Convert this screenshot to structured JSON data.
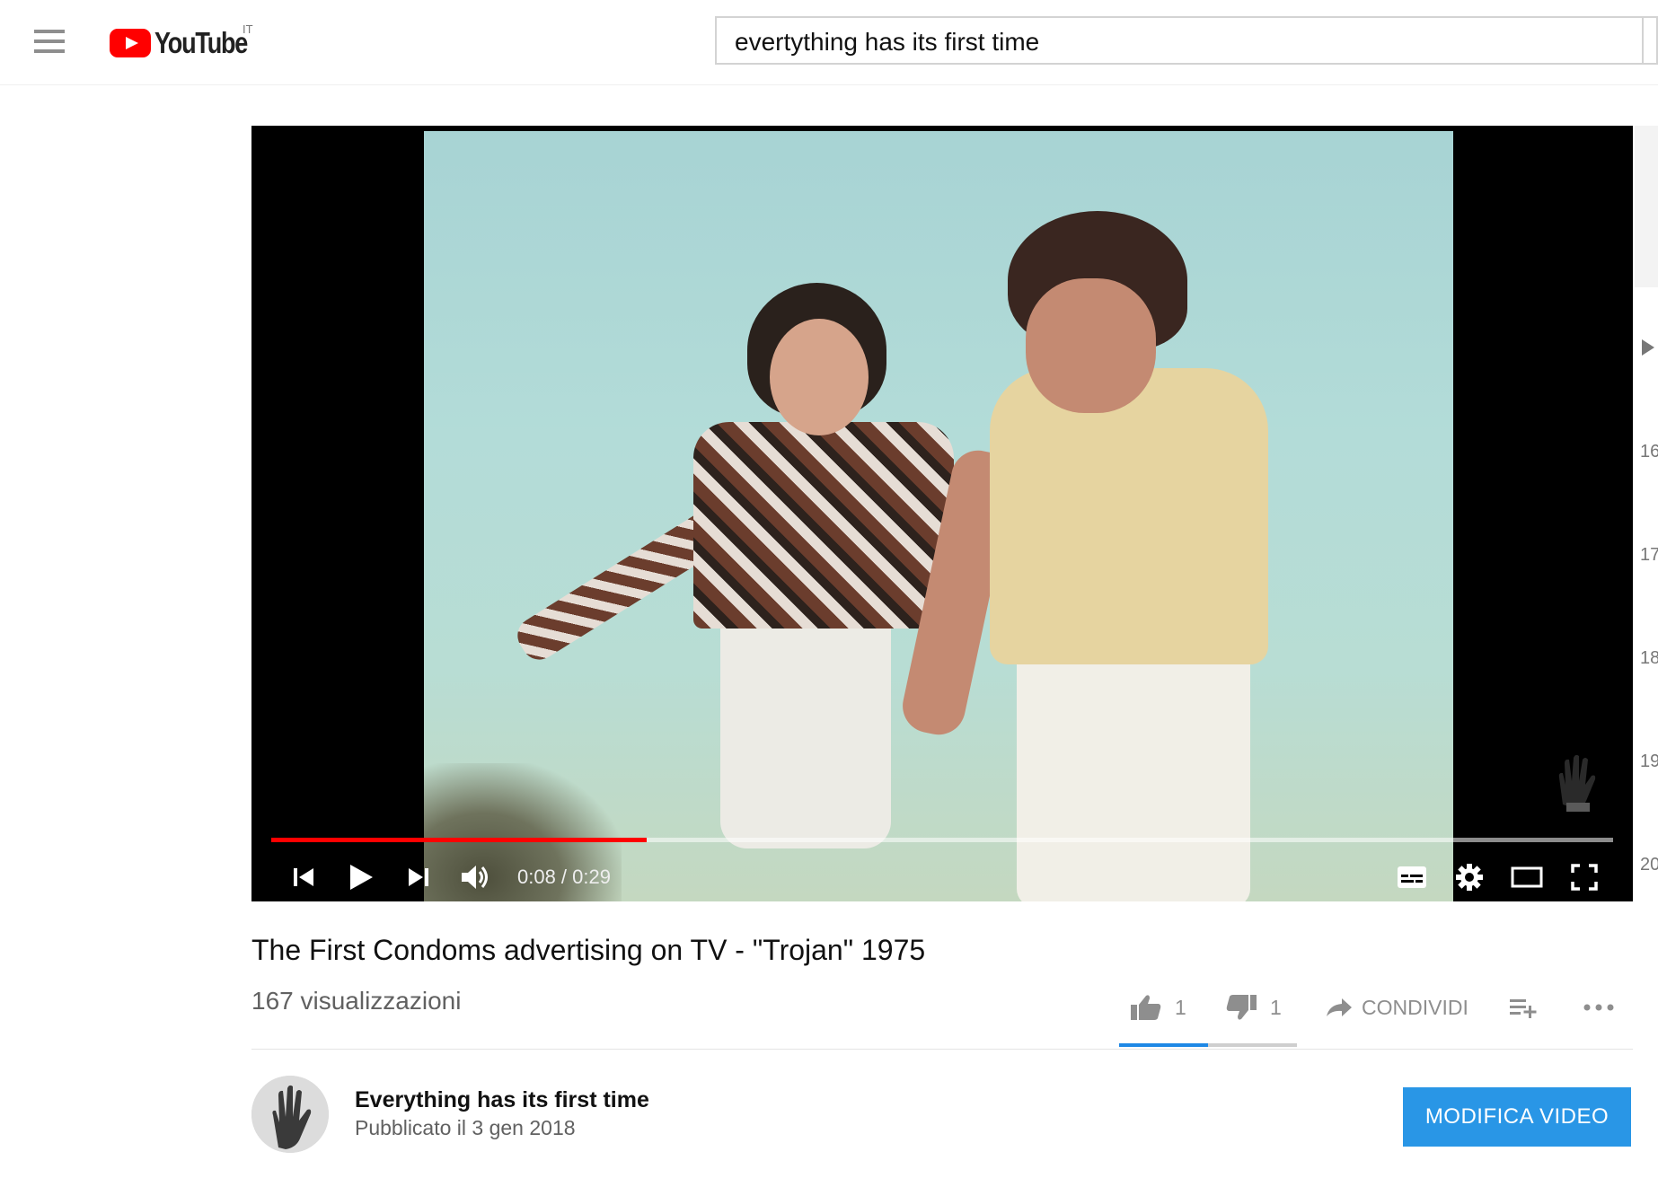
{
  "header": {
    "menu_icon": "hamburger-menu-icon",
    "logo_text": "YouTube",
    "country_code": "IT",
    "search_query": "evertything has its first time"
  },
  "player": {
    "current_time": "0:08",
    "duration": "0:29",
    "time_display": "0:08 / 0:29",
    "progress": 0.28,
    "colors": {
      "progress": "#ff0000",
      "background": "#000000"
    },
    "icons": [
      "previous-icon",
      "play-icon",
      "next-icon",
      "volume-icon",
      "subtitles-icon",
      "settings-icon",
      "theater-mode-icon",
      "fullscreen-icon"
    ]
  },
  "video": {
    "title": "The First Condoms advertising on TV - \"Trojan\" 1975",
    "views": "167 visualizzazioni",
    "likes": "1",
    "dislikes": "1",
    "share_label": "CONDIVIDI",
    "like_ratio": 0.5,
    "accent": "#1e88e5"
  },
  "channel": {
    "name": "Everything has its first time",
    "published": "Pubblicato il 3 gen 2018",
    "edit_button": "MODIFICA VIDEO",
    "button_color": "#2996e6"
  },
  "sidebar_partial": {
    "numbers": [
      "16",
      "17",
      "18",
      "19",
      "20"
    ]
  }
}
